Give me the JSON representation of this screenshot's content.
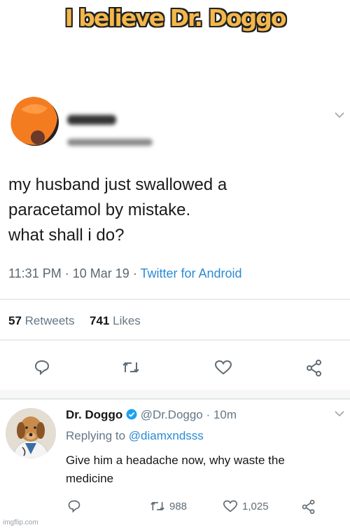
{
  "caption": "I believe Dr. Doggo",
  "tweet": {
    "text_lines": [
      "my husband just swallowed a",
      "paracetamol by mistake.",
      "what shall i do?"
    ],
    "time": "11:31 PM",
    "sep": "·",
    "date": "10 Mar 19",
    "client": "Twitter for Android",
    "retweets_count": "57",
    "retweets_label": "Retweets",
    "likes_count": "741",
    "likes_label": "Likes"
  },
  "reply": {
    "name": "Dr. Doggo",
    "handle": "@Dr.Doggo",
    "time": "10m",
    "replying_prefix": "Replying to",
    "replying_to": "@diamxndsss",
    "text_lines": [
      "Give him a headache now, why waste the",
      "medicine"
    ],
    "retweets": "988",
    "likes": "1,025"
  },
  "watermark": "imgflip.com",
  "colors": {
    "caption": "#f4b74a",
    "link": "#2a8bd5",
    "verified": "#1da1f2",
    "avatar_orange": "#f47c20"
  },
  "icons": [
    "reply-icon",
    "retweet-icon",
    "like-icon",
    "share-icon",
    "verified-badge-icon",
    "chevron-down-icon"
  ]
}
